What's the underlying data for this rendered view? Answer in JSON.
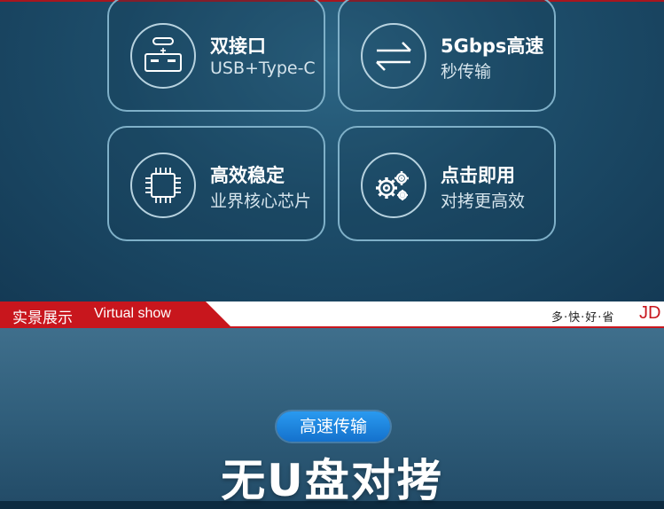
{
  "features": [
    {
      "title": "双接口",
      "subtitle": "USB+Type-C",
      "icon": "usb-port-icon"
    },
    {
      "title": "5Gbps高速",
      "subtitle": "秒传输",
      "icon": "transfer-arrows-icon"
    },
    {
      "title": "高效稳定",
      "subtitle": "业界核心芯片",
      "icon": "chip-icon"
    },
    {
      "title": "点击即用",
      "subtitle": "对拷更高效",
      "icon": "gears-icon"
    }
  ],
  "banner": {
    "title": "实景展示",
    "subtitle": "Virtual show",
    "slogan": "多·快·好·省",
    "brand": "JD"
  },
  "pill_label": "高速传输",
  "headline": "无U盘对拷",
  "colors": {
    "card_border": "#7fb0c8",
    "accent_red": "#c8161d",
    "pill_blue": "#1e88e5",
    "background_top": "#1d4d6a",
    "background_bottom": "#2f5d7a"
  }
}
